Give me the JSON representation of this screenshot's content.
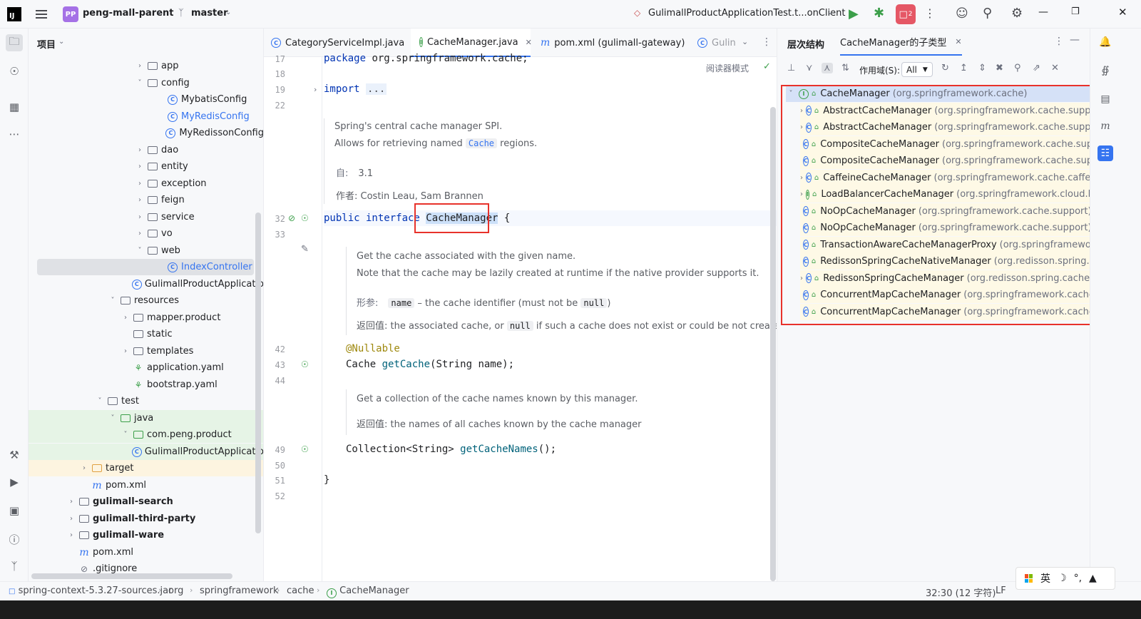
{
  "titlebar": {
    "logo": "IJ",
    "project_badge": "PP",
    "project_name": "peng-mall-parent",
    "branch": "master",
    "run_config": "GulimallProductApplicationTest.t...onClient",
    "stop_badge": "2",
    "icons": [
      "hamburger-icon",
      "branch-icon",
      "run-icon",
      "debug-icon",
      "stop-icon",
      "more-icon",
      "user-icon",
      "search-icon",
      "settings-icon",
      "minimize-icon",
      "maximize-icon",
      "close-icon"
    ]
  },
  "project_panel": {
    "title": "项目",
    "tree": [
      {
        "label": "app",
        "type": "folder",
        "expanded": false
      },
      {
        "label": "config",
        "type": "folder",
        "expanded": true
      },
      {
        "label": "MybatisConfig",
        "type": "class"
      },
      {
        "label": "MyRedisConfig",
        "type": "class"
      },
      {
        "label": "MyRedissonConfig",
        "type": "class"
      },
      {
        "label": "dao",
        "type": "folder",
        "expanded": false
      },
      {
        "label": "entity",
        "type": "folder",
        "expanded": false
      },
      {
        "label": "exception",
        "type": "folder",
        "expanded": false
      },
      {
        "label": "feign",
        "type": "folder",
        "expanded": false
      },
      {
        "label": "service",
        "type": "folder",
        "expanded": false
      },
      {
        "label": "vo",
        "type": "folder",
        "expanded": false
      },
      {
        "label": "web",
        "type": "folder",
        "expanded": true
      },
      {
        "label": "IndexController",
        "type": "class"
      },
      {
        "label": "GulimallProductApplicatio",
        "type": "class"
      },
      {
        "label": "resources",
        "type": "folder",
        "expanded": true
      },
      {
        "label": "mapper.product",
        "type": "folder",
        "expanded": false
      },
      {
        "label": "static",
        "type": "folder"
      },
      {
        "label": "templates",
        "type": "folder",
        "expanded": false
      },
      {
        "label": "application.yaml",
        "type": "yaml"
      },
      {
        "label": "bootstrap.yaml",
        "type": "yaml"
      },
      {
        "label": "test",
        "type": "folder",
        "expanded": true
      },
      {
        "label": "java",
        "type": "folder",
        "expanded": true
      },
      {
        "label": "com.peng.product",
        "type": "folder",
        "expanded": true
      },
      {
        "label": "GulimallProductApplicatio",
        "type": "class"
      },
      {
        "label": "target",
        "type": "folder",
        "expanded": false
      },
      {
        "label": "pom.xml",
        "type": "maven"
      },
      {
        "label": "gulimall-search",
        "type": "module",
        "expanded": false
      },
      {
        "label": "gulimall-third-party",
        "type": "module",
        "expanded": false
      },
      {
        "label": "gulimall-ware",
        "type": "module",
        "expanded": false
      },
      {
        "label": "pom.xml",
        "type": "maven"
      },
      {
        "label": ".gitignore",
        "type": "ignore"
      }
    ]
  },
  "editor": {
    "tabs": [
      {
        "label": "CategoryServiceImpl.java",
        "active": false
      },
      {
        "label": "CacheManager.java",
        "active": true
      },
      {
        "label": "pom.xml (gulimall-gateway)",
        "active": false
      },
      {
        "label": "Gulin",
        "active": false
      }
    ],
    "reader_mode": "阅读器模式",
    "line_numbers": [
      "17",
      "18",
      "19",
      "22",
      "32",
      "33",
      "42",
      "43",
      "44",
      "49",
      "50",
      "51",
      "52"
    ],
    "code": {
      "package_kw": "package",
      "package_name": " org.springframework.cache;",
      "import_kw": "import",
      "import_fold": "...",
      "public_kw": "public",
      "interface_kw": " interface ",
      "iface_name": "CacheManager",
      "brace_open": " {",
      "nullable": "@Nullable",
      "cache_type": "Cache ",
      "get_cache": "getCache",
      "get_cache_params": "(String name);",
      "collection_type": "Collection<String> ",
      "get_cache_names": "getCacheNames",
      "get_cache_names_params": "();",
      "brace_close": "}"
    },
    "doc1": {
      "line1": "Spring's central cache manager SPI.",
      "line2_a": "Allows for retrieving named ",
      "line2_code": "Cache",
      "line2_b": " regions.",
      "since_key": "自:",
      "since_val": "3.1",
      "author_key": "作者:",
      "author_val": "Costin Leau, Sam Brannen"
    },
    "doc2": {
      "line1": "Get the cache associated with the given name.",
      "line2": "Note that the cache may be lazily created at runtime if the native provider supports it.",
      "param_key": "形参:",
      "param_code": "name",
      "param_desc_a": " – the cache identifier (must not be ",
      "param_null": "null",
      "param_desc_b": ")",
      "return_key": "返回值:",
      "return_a": "the associated cache, or ",
      "return_null": "null",
      "return_b": " if such a cache does not exist or could be not created"
    },
    "doc3": {
      "line1": "Get a collection of the cache names known by this manager.",
      "return_key": "返回值:",
      "return_val": "the names of all caches known by the cache manager"
    }
  },
  "hierarchy": {
    "title": "层次结构",
    "tab": "CacheManager的子类型",
    "scope_label": "作用域(S):",
    "scope_value": "All",
    "items": [
      {
        "name": "CacheManager",
        "pkg": "(org.springframework.cache)",
        "kind": "interface",
        "root": true,
        "expandable": true
      },
      {
        "name": "AbstractCacheManager",
        "pkg": "(org.springframework.cache.support)",
        "kind": "class",
        "expandable": true
      },
      {
        "name": "AbstractCacheManager",
        "pkg": "(org.springframework.cache.support)",
        "kind": "class",
        "expandable": true
      },
      {
        "name": "CompositeCacheManager",
        "pkg": "(org.springframework.cache.suppo",
        "kind": "class",
        "expandable": false
      },
      {
        "name": "CompositeCacheManager",
        "pkg": "(org.springframework.cache.suppo",
        "kind": "class",
        "expandable": false
      },
      {
        "name": "CaffeineCacheManager",
        "pkg": "(org.springframework.cache.caffeine)",
        "kind": "class",
        "expandable": true
      },
      {
        "name": "LoadBalancerCacheManager",
        "pkg": "(org.springframework.cloud.loa",
        "kind": "interface",
        "expandable": true
      },
      {
        "name": "NoOpCacheManager",
        "pkg": "(org.springframework.cache.support)",
        "kind": "class",
        "expandable": false
      },
      {
        "name": "NoOpCacheManager",
        "pkg": "(org.springframework.cache.support)",
        "kind": "class",
        "expandable": false
      },
      {
        "name": "TransactionAwareCacheManagerProxy",
        "pkg": "(org.springframework.",
        "kind": "class",
        "expandable": false
      },
      {
        "name": "RedissonSpringCacheNativeManager",
        "pkg": "(org.redisson.spring.cac",
        "kind": "class",
        "expandable": false
      },
      {
        "name": "RedissonSpringCacheManager",
        "pkg": "(org.redisson.spring.cache)",
        "kind": "class",
        "expandable": true
      },
      {
        "name": "ConcurrentMapCacheManager",
        "pkg": "(org.springframework.cache.c",
        "kind": "class",
        "expandable": false
      },
      {
        "name": "ConcurrentMapCacheManager",
        "pkg": "(org.springframework.cache.c",
        "kind": "class",
        "expandable": false
      }
    ]
  },
  "statusbar": {
    "crumbs": [
      "spring-context-5.3.27-sources.jar",
      "org",
      "springframework",
      "cache",
      "CacheManager"
    ],
    "position": "32:30 (12 字符)",
    "line_sep": "LF"
  },
  "ime": {
    "lang": "英"
  },
  "colors": {
    "accent": "#3574f0",
    "highlight_box": "#e8322b",
    "hierarchy_row_bg": "#fef9e6",
    "run_green": "#3c9f4a",
    "stop_red": "#e55765"
  }
}
